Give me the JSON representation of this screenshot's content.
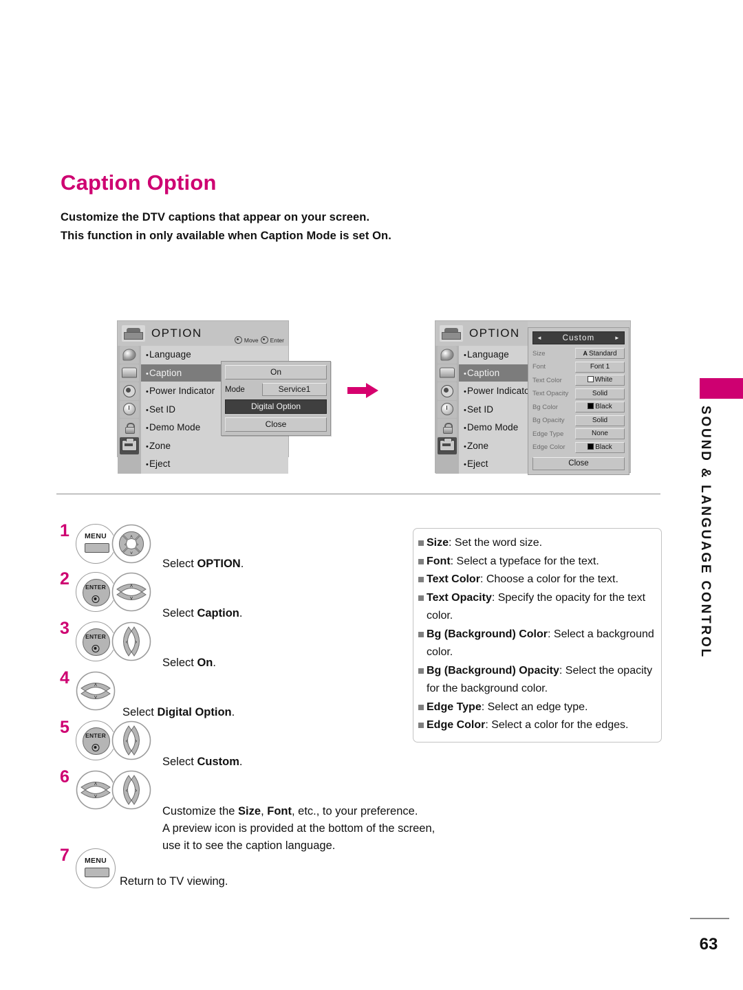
{
  "page": {
    "title": "Caption Option",
    "intro_line_1": "Customize the DTV captions that appear on your screen.",
    "intro_line_2": "This function in only available when Caption Mode is set On.",
    "number": "63",
    "side_tab": "SOUND & LANGUAGE CONTROL",
    "accent_color": "#CE0071"
  },
  "osd_first": {
    "title": "OPTION",
    "hint_move": "Move",
    "hint_enter": "Enter",
    "sidebar_icons": [
      "dish-icon",
      "tv-icon",
      "audio-icon",
      "clock-icon",
      "lock-icon",
      "option-icon"
    ],
    "menu_items": [
      {
        "label": "Language",
        "selected": false
      },
      {
        "label": "Caption",
        "selected": true
      },
      {
        "label": "Power Indicator",
        "selected": false
      },
      {
        "label": "Set ID",
        "selected": false
      },
      {
        "label": "Demo Mode",
        "selected": false
      },
      {
        "label": "Zone",
        "selected": false
      },
      {
        "label": "Eject",
        "selected": false
      }
    ],
    "popup": {
      "on_label": "On",
      "mode_label": "Mode",
      "mode_value": "Service1",
      "digital_option_label": "Digital Option",
      "close_label": "Close"
    }
  },
  "osd_second": {
    "title": "OPTION",
    "menu_items": [
      {
        "label": "Language"
      },
      {
        "label": "Caption"
      },
      {
        "label": "Power Indicato"
      },
      {
        "label": "Set ID"
      },
      {
        "label": "Demo Mode"
      },
      {
        "label": "Zone"
      },
      {
        "label": "Eject"
      }
    ],
    "custom_panel": {
      "header": "Custom",
      "arrow_left": "◄",
      "arrow_right": "►",
      "rows": [
        {
          "label": "Size",
          "value": "Standard",
          "swatch": "A"
        },
        {
          "label": "Font",
          "value": "Font 1",
          "swatch": ""
        },
        {
          "label": "Text Color",
          "value": "White",
          "swatch": "white"
        },
        {
          "label": "Text Opacity",
          "value": "Solid",
          "swatch": ""
        },
        {
          "label": "Bg Color",
          "value": "Black",
          "swatch": "black"
        },
        {
          "label": "Bg Opacity",
          "value": "Solid",
          "swatch": ""
        },
        {
          "label": "Edge Type",
          "value": "None",
          "swatch": ""
        },
        {
          "label": "Edge Color",
          "value": "Black",
          "swatch": "black"
        }
      ],
      "close_label": "Close"
    }
  },
  "steps": [
    {
      "num": "1",
      "buttons": [
        "menu",
        "nav4"
      ],
      "text_html": "Select <b>OPTION</b>."
    },
    {
      "num": "2",
      "buttons": [
        "enter",
        "updown"
      ],
      "text_html": "Select <b>Caption</b>."
    },
    {
      "num": "3",
      "buttons": [
        "enter",
        "leftright"
      ],
      "text_html": "Select <b>On</b>."
    },
    {
      "num": "4",
      "buttons": [
        "updown"
      ],
      "text_html": "Select <b>Digital Option</b>."
    },
    {
      "num": "5",
      "buttons": [
        "enter",
        "leftright"
      ],
      "text_html": "Select <b>Custom</b>."
    },
    {
      "num": "6",
      "buttons": [
        "updown",
        "leftright"
      ],
      "text_html": "Customize the <b>Size</b>, <b>Font</b>, etc., to your preference.<br>A preview icon is provided at the bottom of the screen,<br>use it to see the caption language."
    },
    {
      "num": "7",
      "buttons": [
        "menu"
      ],
      "text_html": "Return to TV viewing."
    }
  ],
  "descriptions": [
    {
      "term": "Size",
      "body": ": Set the word size."
    },
    {
      "term": "Font",
      "body": ": Select a typeface for the text."
    },
    {
      "term": "Text Color",
      "body": ": Choose a color for the text."
    },
    {
      "term": "Text Opacity",
      "body": ": Specify the opacity for the text color."
    },
    {
      "term": "Bg (Background) Color",
      "body": ": Select a background color."
    },
    {
      "term": "Bg (Background) Opacity",
      "body": ": Select the opacity for the background color."
    },
    {
      "term": "Edge Type",
      "body": ": Select an edge type."
    },
    {
      "term": "Edge Color",
      "body": ": Select a color for the edges."
    }
  ],
  "remote_labels": {
    "menu": "MENU",
    "enter": "ENTER"
  }
}
